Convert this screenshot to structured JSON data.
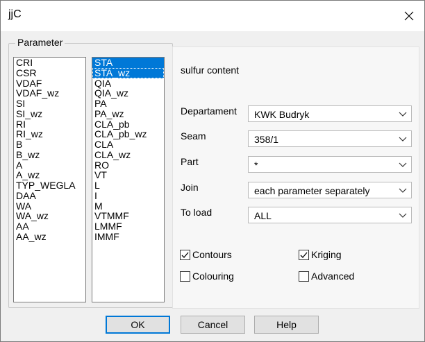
{
  "window": {
    "title": "jjC"
  },
  "group": {
    "label": "Parameter"
  },
  "list_left": {
    "items": [
      "CRI",
      "CSR",
      "VDAF",
      "VDAF_wz",
      "SI",
      "SI_wz",
      "RI",
      "RI_wz",
      "B",
      "B_wz",
      "A",
      "A_wz",
      "TYP_WEGLA",
      "DAA",
      "WA",
      "WA_wz",
      "AA",
      "AA_wz"
    ]
  },
  "list_right": {
    "items": [
      "STA",
      "STA_wz",
      "QIA",
      "QIA_wz",
      "PA",
      "PA_wz",
      "CLA_pb",
      "CLA_pb_wz",
      "CLA",
      "CLA_wz",
      "RO",
      "VT",
      "L",
      "I",
      "M",
      "VTMMF",
      "LMMF",
      "IMMF"
    ],
    "selected": [
      "STA",
      "STA_wz"
    ]
  },
  "panel": {
    "parameter_name": "sulfur content",
    "fields": [
      {
        "label": "Departament",
        "value": "KWK Budryk"
      },
      {
        "label": "Seam",
        "value": "358/1"
      },
      {
        "label": "Part",
        "value": "*"
      },
      {
        "label": "Join",
        "value": "each parameter separately"
      },
      {
        "label": "To load",
        "value": "ALL"
      }
    ],
    "checkboxes": [
      {
        "label": "Contours",
        "checked": true
      },
      {
        "label": "Kriging",
        "checked": true
      },
      {
        "label": "Colouring",
        "checked": false
      },
      {
        "label": "Advanced",
        "checked": false
      }
    ]
  },
  "buttons": {
    "ok": "OK",
    "cancel": "Cancel",
    "help": "Help"
  },
  "colors": {
    "selection": "#0078d7",
    "face": "#f0f0f0"
  },
  "icons": {
    "close": "close-icon",
    "dropdown": "chevron-down-icon",
    "check": "check-icon"
  }
}
